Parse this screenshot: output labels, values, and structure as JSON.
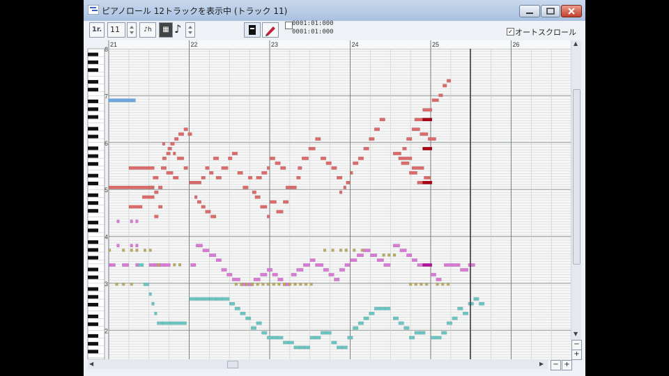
{
  "window": {
    "title": "ピアノロール 12トラックを表示中 (トラック 11)",
    "controls": {
      "minimize": "minimize",
      "maximize": "maximize",
      "close": "close"
    }
  },
  "toolbar": {
    "track_button_label": "1r.",
    "track_number": "11",
    "snap_label": "♪h",
    "grid_label": "▦",
    "note_length_icon": "eighth-note-icon",
    "time_start": "0001:01:000",
    "time_end": "0001:01:000",
    "autoscroll_label": "オートスクロール",
    "autoscroll_checked": "✓"
  },
  "measures": [
    "21",
    "22",
    "23",
    "24",
    "25",
    "26"
  ],
  "octave_labels": [
    "8",
    "7",
    "6",
    "5",
    "4",
    "3",
    "2"
  ],
  "colors": {
    "grid_bg": "#f5f6f5",
    "row_line": "#d4d8d6",
    "octave_line": "#9a9e9c",
    "measure_line": "#7b7f7d",
    "beat_line": "#c8ccca",
    "cursor": "#3a3a3a",
    "note_blue": "#6fa7dd",
    "note_red": "#d96b6b",
    "note_red_dark": "#a80012",
    "note_pink": "#d77ad3",
    "note_magenta": "#b11498",
    "note_olive": "#b9ac62",
    "note_teal": "#6cc3bf"
  },
  "notes": {
    "blue": [
      [
        0,
        2,
        -10
      ]
    ],
    "red": [
      [
        0,
        1.5,
        -28
      ],
      [
        1.5,
        2.5,
        -28
      ],
      [
        2.5,
        3.4,
        -28
      ],
      [
        1.5,
        3.4,
        -24
      ],
      [
        1.5,
        2.5,
        -32
      ],
      [
        2.5,
        3.4,
        -30
      ],
      [
        3.0,
        3.3,
        -28
      ],
      [
        3.3,
        3.7,
        -26
      ],
      [
        3.4,
        3.7,
        -29
      ],
      [
        3.4,
        3.7,
        -34
      ],
      [
        3.7,
        4.0,
        -32
      ],
      [
        3.7,
        4.0,
        -28
      ],
      [
        4.0,
        4.3,
        -22
      ],
      [
        4.3,
        4.6,
        -21
      ],
      [
        4.6,
        4.9,
        -19
      ],
      [
        4.9,
        5.2,
        -18
      ],
      [
        5.2,
        5.6,
        -17
      ],
      [
        5.6,
        5.9,
        -16
      ],
      [
        5.9,
        6.2,
        -17
      ],
      [
        3.9,
        4.3,
        -24
      ],
      [
        4.3,
        4.8,
        -25
      ],
      [
        4.8,
        5.2,
        -26
      ],
      [
        4.0,
        4.2,
        -19
      ],
      [
        4.4,
        4.7,
        -20
      ],
      [
        4.8,
        5.0,
        -21
      ],
      [
        5.1,
        5.6,
        -22
      ],
      [
        5.6,
        5.9,
        -24
      ],
      [
        6.0,
        6.4,
        -27
      ],
      [
        6.4,
        6.9,
        -27
      ],
      [
        6.9,
        7.2,
        -26
      ],
      [
        7.2,
        7.5,
        -24
      ],
      [
        7.5,
        7.8,
        -25
      ],
      [
        7.8,
        8.2,
        -22
      ],
      [
        6.4,
        6.6,
        -30
      ],
      [
        6.6,
        6.9,
        -31
      ],
      [
        6.9,
        7.2,
        -32
      ],
      [
        7.2,
        7.6,
        -33
      ],
      [
        7.6,
        8.0,
        -34
      ],
      [
        8.0,
        8.4,
        -26
      ],
      [
        8.4,
        8.9,
        -24
      ],
      [
        8.9,
        9.2,
        -22
      ],
      [
        9.2,
        9.6,
        -21
      ],
      [
        9.6,
        10.0,
        -25
      ],
      [
        10.0,
        10.4,
        -28
      ],
      [
        10.4,
        10.7,
        -26
      ],
      [
        10.7,
        11.0,
        -29
      ],
      [
        11.0,
        11.4,
        -26
      ],
      [
        11.4,
        11.8,
        -25
      ],
      [
        11.8,
        12.0,
        -24
      ],
      [
        12.0,
        12.4,
        -22
      ],
      [
        12.4,
        12.8,
        -23
      ],
      [
        12.8,
        13.2,
        -24
      ],
      [
        13.2,
        13.6,
        -28
      ],
      [
        13.6,
        14.0,
        -28
      ],
      [
        14.0,
        14.3,
        -26
      ],
      [
        10.9,
        11.3,
        -30
      ],
      [
        11.3,
        11.8,
        -32
      ],
      [
        11.8,
        12.0,
        -34
      ],
      [
        12.0,
        12.5,
        -31
      ],
      [
        12.5,
        13.0,
        -33
      ],
      [
        13.0,
        13.4,
        -31
      ],
      [
        14.1,
        14.4,
        -24
      ],
      [
        14.4,
        14.9,
        -22
      ],
      [
        14.9,
        15.4,
        -20
      ],
      [
        15.4,
        15.8,
        -18
      ],
      [
        15.8,
        16.2,
        -22
      ],
      [
        16.2,
        16.6,
        -23
      ],
      [
        16.6,
        17.0,
        -24
      ],
      [
        17.0,
        17.4,
        -26
      ],
      [
        17.2,
        17.4,
        -29
      ],
      [
        17.5,
        17.7,
        -28
      ],
      [
        17.7,
        18.0,
        -27
      ],
      [
        18.0,
        18.2,
        -25
      ],
      [
        18.2,
        18.6,
        -23
      ],
      [
        18.6,
        19.0,
        -22
      ],
      [
        19.0,
        19.4,
        -20
      ],
      [
        19.4,
        19.8,
        -18
      ],
      [
        19.8,
        20.2,
        -16
      ],
      [
        20.2,
        20.6,
        -14
      ],
      [
        21.6,
        22.6,
        -22
      ],
      [
        22.6,
        23.5,
        -24
      ],
      [
        23.5,
        24.0,
        -26
      ],
      [
        21.9,
        22.2,
        -20
      ],
      [
        22.2,
        22.6,
        -18
      ],
      [
        22.6,
        23.2,
        -16
      ],
      [
        23.2,
        23.8,
        -17
      ],
      [
        23.8,
        24.4,
        -18
      ],
      [
        21.2,
        21.8,
        -21
      ],
      [
        21.8,
        22.4,
        -23
      ],
      [
        22.4,
        23.0,
        -25
      ],
      [
        23.0,
        23.4,
        -27
      ],
      [
        22.8,
        23.4,
        -14
      ],
      [
        23.4,
        24.1,
        -12
      ],
      [
        24.1,
        24.6,
        -10
      ],
      [
        24.6,
        24.9,
        -9
      ],
      [
        24.9,
        25.2,
        -7
      ],
      [
        25.2,
        25.5,
        -6
      ]
    ],
    "red_dark": [
      [
        23.4,
        24.1,
        -14
      ],
      [
        23.4,
        24.1,
        -20
      ],
      [
        23.4,
        24.1,
        -27
      ]
    ],
    "pink": [
      [
        0,
        0.5,
        -44
      ],
      [
        1.0,
        1.5,
        -44
      ],
      [
        2.0,
        2.2,
        -44
      ],
      [
        3.0,
        3.4,
        -44
      ],
      [
        3.4,
        3.8,
        -44
      ],
      [
        3.8,
        4.2,
        -44
      ],
      [
        4.2,
        4.6,
        -44
      ],
      [
        6.1,
        6.5,
        -44
      ],
      [
        6.5,
        7.0,
        -40
      ],
      [
        7.0,
        7.5,
        -41
      ],
      [
        7.5,
        8.0,
        -42
      ],
      [
        8.0,
        8.4,
        -43
      ],
      [
        8.4,
        8.8,
        -45
      ],
      [
        8.8,
        9.2,
        -46
      ],
      [
        9.2,
        9.8,
        -47
      ],
      [
        9.8,
        10.3,
        -48
      ],
      [
        10.3,
        10.8,
        -48
      ],
      [
        10.8,
        11.3,
        -47
      ],
      [
        11.3,
        11.8,
        -46
      ],
      [
        11.8,
        12.2,
        -45
      ],
      [
        12.2,
        12.6,
        -46
      ],
      [
        12.6,
        13.0,
        -47
      ],
      [
        13.0,
        13.5,
        -48
      ],
      [
        13.6,
        14.0,
        -46
      ],
      [
        14.0,
        14.5,
        -45
      ],
      [
        14.5,
        15.0,
        -44
      ],
      [
        15.0,
        15.4,
        -43
      ],
      [
        15.4,
        16.0,
        -44
      ],
      [
        16.0,
        16.4,
        -45
      ],
      [
        16.4,
        16.8,
        -46
      ],
      [
        16.8,
        17.2,
        -47
      ],
      [
        17.2,
        17.6,
        -45
      ],
      [
        17.6,
        18.0,
        -44
      ],
      [
        18.0,
        18.5,
        -43
      ],
      [
        18.5,
        19.0,
        -42
      ],
      [
        19.0,
        19.5,
        -41
      ],
      [
        19.5,
        20.0,
        -42
      ],
      [
        20.0,
        20.5,
        -43
      ],
      [
        20.5,
        21.0,
        -44
      ],
      [
        21.2,
        21.7,
        -40
      ],
      [
        21.7,
        22.2,
        -41
      ],
      [
        22.2,
        22.6,
        -42
      ],
      [
        22.6,
        23.0,
        -43
      ],
      [
        23.0,
        23.4,
        -44
      ],
      [
        24.0,
        24.4,
        -46
      ],
      [
        24.4,
        24.8,
        -47
      ],
      [
        25.0,
        25.6,
        -44
      ],
      [
        25.6,
        26.2,
        -44
      ],
      [
        26.2,
        26.8,
        -45
      ],
      [
        26.8,
        27.3,
        -44
      ]
    ],
    "pink_small": [
      [
        0.6,
        0.8,
        -35
      ],
      [
        0.6,
        0.8,
        -40
      ],
      [
        1.6,
        1.8,
        -35
      ],
      [
        2.0,
        2.2,
        -35
      ],
      [
        1.6,
        1.8,
        -40
      ],
      [
        2.0,
        2.2,
        -40
      ]
    ],
    "magenta": [
      [
        23.4,
        24.1,
        -44
      ]
    ],
    "olive": [
      [
        0,
        0.1,
        -41
      ],
      [
        1.0,
        1.2,
        -41
      ],
      [
        1.6,
        1.8,
        -41
      ],
      [
        2.0,
        2.2,
        -41
      ],
      [
        2.6,
        2.8,
        -41
      ],
      [
        3.0,
        3.2,
        -41
      ],
      [
        0.5,
        0.7,
        -48
      ],
      [
        1.0,
        1.2,
        -48
      ],
      [
        1.6,
        1.8,
        -48
      ],
      [
        3.6,
        3.8,
        -44
      ],
      [
        4.8,
        5.0,
        -44
      ],
      [
        5.2,
        5.4,
        -44
      ],
      [
        9.4,
        9.6,
        -48
      ],
      [
        9.8,
        10.0,
        -48
      ],
      [
        10.2,
        10.4,
        -48
      ],
      [
        10.6,
        10.8,
        -48
      ],
      [
        11.0,
        11.2,
        -48
      ],
      [
        11.4,
        11.6,
        -48
      ],
      [
        11.8,
        12.0,
        -48
      ],
      [
        12.2,
        12.4,
        -48
      ],
      [
        12.6,
        12.8,
        -48
      ],
      [
        13.0,
        13.2,
        -48
      ],
      [
        13.4,
        13.6,
        -48
      ],
      [
        13.8,
        14.0,
        -48
      ],
      [
        14.2,
        14.4,
        -48
      ],
      [
        14.6,
        14.8,
        -48
      ],
      [
        15.0,
        15.2,
        -48
      ],
      [
        16.0,
        16.2,
        -41
      ],
      [
        16.6,
        16.8,
        -41
      ],
      [
        17.2,
        17.4,
        -41
      ],
      [
        17.6,
        17.8,
        -41
      ],
      [
        18.2,
        18.4,
        -41
      ],
      [
        18.8,
        19.0,
        -41
      ],
      [
        22.4,
        22.6,
        -48
      ],
      [
        22.8,
        23.0,
        -48
      ],
      [
        23.2,
        23.4,
        -48
      ],
      [
        23.6,
        23.8,
        -48
      ],
      [
        24.4,
        24.6,
        -48
      ],
      [
        24.8,
        25.0,
        -48
      ],
      [
        25.2,
        25.4,
        -48
      ],
      [
        20.4,
        20.6,
        -42
      ],
      [
        20.8,
        21.0,
        -42
      ],
      [
        21.2,
        21.4,
        -42
      ]
    ],
    "teal": [
      [
        2.2,
        2.6,
        -44
      ],
      [
        2.6,
        3.0,
        -48
      ],
      [
        3.0,
        3.2,
        -50
      ],
      [
        3.2,
        3.4,
        -52
      ],
      [
        3.4,
        3.6,
        -54
      ],
      [
        3.6,
        4.0,
        -56
      ],
      [
        4.0,
        4.6,
        -56
      ],
      [
        4.6,
        5.2,
        -56
      ],
      [
        5.2,
        5.8,
        -56
      ],
      [
        6.0,
        6.5,
        -51
      ],
      [
        6.5,
        7.0,
        -51
      ],
      [
        7.0,
        7.5,
        -51
      ],
      [
        7.5,
        8.0,
        -51
      ],
      [
        8.0,
        8.5,
        -51
      ],
      [
        8.5,
        9.0,
        -51
      ],
      [
        9.0,
        9.4,
        -52
      ],
      [
        9.4,
        9.8,
        -53
      ],
      [
        9.8,
        10.2,
        -54
      ],
      [
        10.2,
        10.6,
        -55
      ],
      [
        10.6,
        11.0,
        -57
      ],
      [
        11.0,
        11.4,
        -56
      ],
      [
        11.4,
        11.8,
        -58
      ],
      [
        11.8,
        12.2,
        -59
      ],
      [
        12.2,
        12.6,
        -59
      ],
      [
        12.6,
        13.0,
        -59
      ],
      [
        13.0,
        13.4,
        -60
      ],
      [
        13.4,
        13.8,
        -60
      ],
      [
        13.8,
        14.2,
        -61
      ],
      [
        14.2,
        14.6,
        -61
      ],
      [
        14.6,
        15.0,
        -61
      ],
      [
        15.0,
        15.4,
        -59
      ],
      [
        15.4,
        15.8,
        -59
      ],
      [
        15.8,
        16.2,
        -58
      ],
      [
        16.2,
        16.6,
        -58
      ],
      [
        16.6,
        17.0,
        -60
      ],
      [
        17.0,
        17.4,
        -61
      ],
      [
        17.4,
        17.8,
        -61
      ],
      [
        17.8,
        18.2,
        -59
      ],
      [
        18.2,
        18.6,
        -57
      ],
      [
        18.6,
        19.0,
        -56
      ],
      [
        19.0,
        19.4,
        -55
      ],
      [
        19.4,
        19.8,
        -54
      ],
      [
        19.8,
        20.2,
        -53
      ],
      [
        20.2,
        20.6,
        -53
      ],
      [
        20.6,
        21.0,
        -53
      ],
      [
        21.2,
        21.6,
        -55
      ],
      [
        21.6,
        22.0,
        -56
      ],
      [
        22.0,
        22.4,
        -57
      ],
      [
        22.4,
        22.8,
        -59
      ],
      [
        22.8,
        23.2,
        -58
      ],
      [
        23.2,
        23.6,
        -58
      ],
      [
        24.0,
        24.4,
        -59
      ],
      [
        24.4,
        24.8,
        -59
      ],
      [
        24.8,
        25.2,
        -58
      ],
      [
        25.2,
        25.6,
        -56
      ],
      [
        25.6,
        26.0,
        -55
      ],
      [
        26.0,
        26.4,
        -53
      ],
      [
        26.4,
        26.8,
        -54
      ],
      [
        26.8,
        27.2,
        -52
      ],
      [
        27.2,
        27.6,
        -51
      ],
      [
        27.6,
        28.0,
        -52
      ]
    ]
  }
}
